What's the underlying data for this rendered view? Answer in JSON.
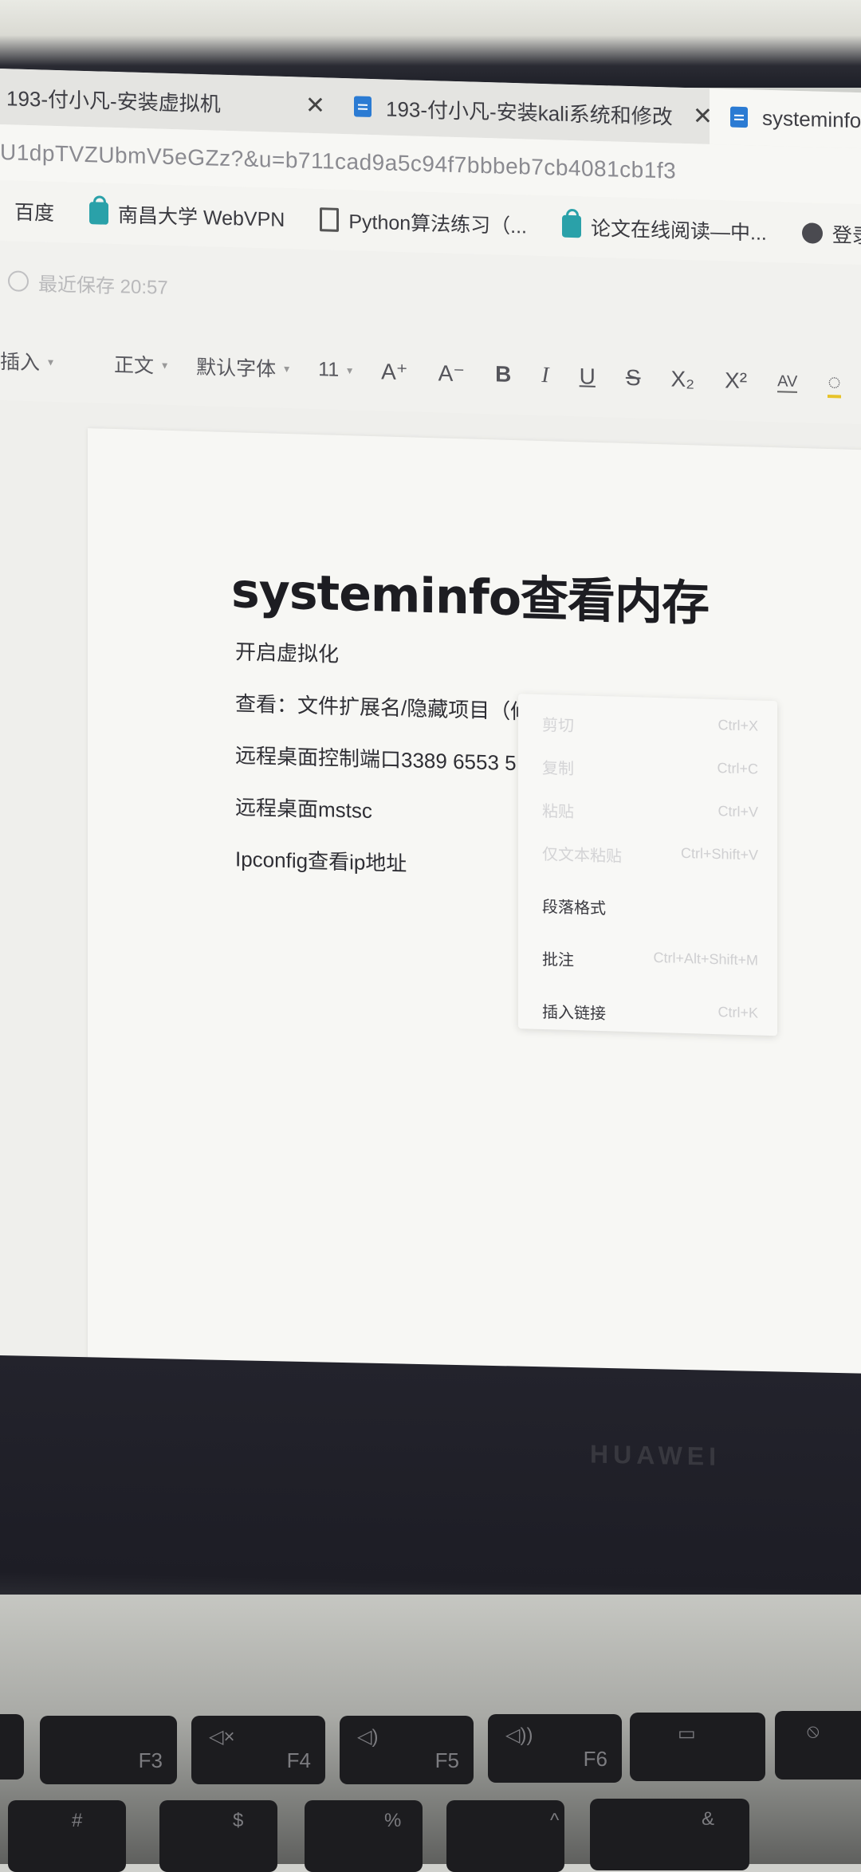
{
  "browser": {
    "tabs": [
      {
        "label": "193-付小凡-安装虚拟机",
        "close": "✕"
      },
      {
        "label": "193-付小凡-安装kali系统和修改",
        "close": "✕"
      },
      {
        "label": "systeminfo"
      }
    ],
    "url": "U1dpTVZUbmV5eGZz?&u=b711cad9a5c94f7bbbeb7cb4081cb1f3",
    "bookmarks": [
      "百度",
      "南昌大学 WebVPN",
      "Python算法练习（...",
      "论文在线阅读—中...",
      "登录注册"
    ]
  },
  "editor": {
    "save_status": "最近保存 20:57",
    "toolbar": {
      "insert": "插入",
      "style": "正文",
      "font": "默认字体",
      "size": "11",
      "grow": "A⁺",
      "shrink": "A⁻",
      "bold": "B",
      "italic": "I",
      "underline": "U",
      "strike": "S",
      "subscript": "X₂",
      "superscript": "X²",
      "spacing": "AV"
    },
    "document": {
      "title": "systeminfo查看内存",
      "paragraphs": [
        "开启虚拟化",
        "查看：文件扩展名/隐藏项目（修改文件属性）",
        "远程桌面控制端口3389  6553 5",
        "远程桌面mstsc",
        "Ipconfig查看ip地址"
      ]
    },
    "context_menu": [
      {
        "label": "剪切",
        "shortcut": "Ctrl+X",
        "enabled": false
      },
      {
        "label": "复制",
        "shortcut": "Ctrl+C",
        "enabled": false
      },
      {
        "label": "粘贴",
        "shortcut": "Ctrl+V",
        "enabled": false
      },
      {
        "label": "仅文本粘贴",
        "shortcut": "Ctrl+Shift+V",
        "enabled": false
      },
      {
        "label": "段落格式",
        "shortcut": "",
        "enabled": true
      },
      {
        "label": "批注",
        "shortcut": "Ctrl+Alt+Shift+M",
        "enabled": true
      },
      {
        "label": "插入链接",
        "shortcut": "Ctrl+K",
        "enabled": true
      }
    ]
  },
  "laptop": {
    "brand": "HUAWEI",
    "fkeys": [
      "F3",
      "F4",
      "F5",
      "F6"
    ],
    "number_row": [
      "#",
      "$",
      "%",
      "^",
      "&"
    ]
  }
}
